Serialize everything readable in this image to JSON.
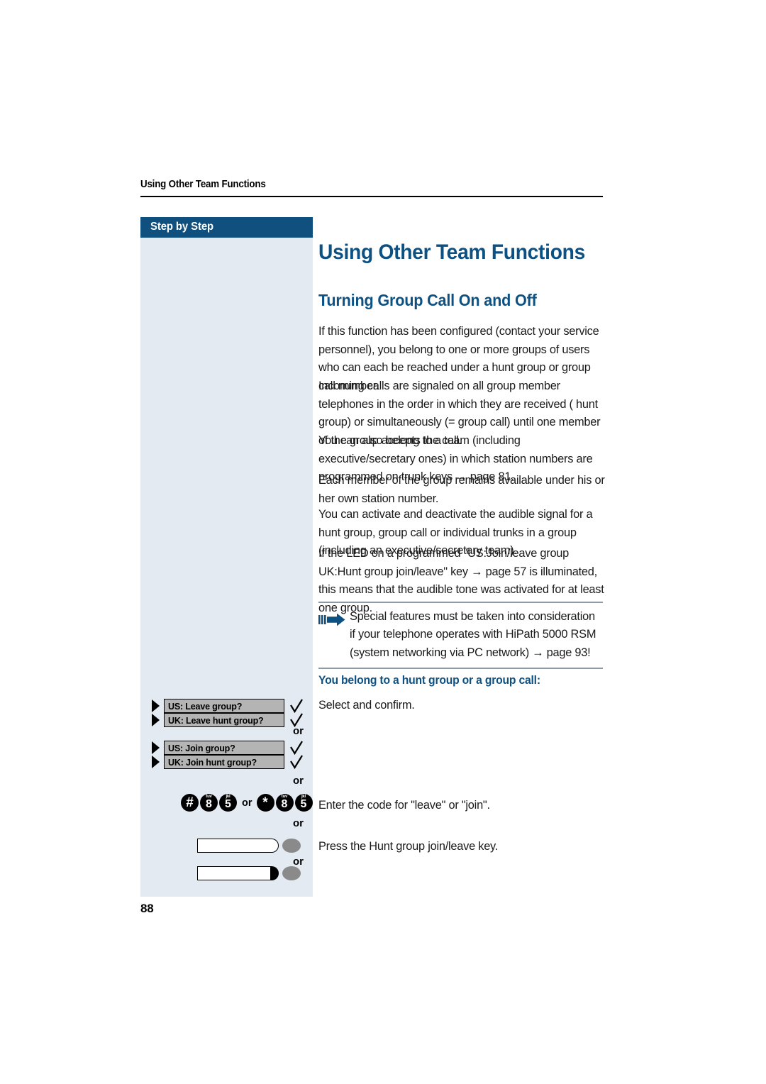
{
  "document": {
    "running_header": "Using Other Team Functions",
    "page_number": "88"
  },
  "sidebar": {
    "header_label": "Step by Step"
  },
  "headings": {
    "h1": "Using Other Team Functions",
    "h2": "Turning Group Call On and Off",
    "h3": "You belong to a hunt group or a group call:"
  },
  "body": {
    "para1": "If this function has been configured (contact your service personnel), you belong to one or more groups of users who can each be reached under a hunt group or group call number.",
    "para2": "Incoming calls are signaled on all group member telephones in the order in which they are received ( hunt group) or simultaneously (= group call) until one member of the group accepts the call.",
    "para3": "You can also belong to a team (including executive/secretary ones) in which station numbers are programmed on trunk keys → page 81.",
    "para4": "Each member of the group remains available under his or her own station number.",
    "para5": "You can activate and deactivate the audible signal for a hunt group, group call or individual trunks in a group (including an executive/secretary team).",
    "para6": "If the LED on a programmed \"US:Join/leave group UK:Hunt group join/leave\" key → page 57 is illuminated, this means that the audible tone was activated for at least one group."
  },
  "note": {
    "icon": "hand-pointer-arrow-icon",
    "text": "Special features must be taken into consideration if your telephone operates with HiPath 5000 RSM (system networking via PC network) → page 93!"
  },
  "steps": {
    "dialog_options": [
      {
        "label": "US: Leave group?",
        "confirm_icon": "check-icon"
      },
      {
        "label": "UK: Leave hunt group?",
        "confirm_icon": "check-icon"
      },
      {
        "label": "US: Join group?",
        "confirm_icon": "check-icon"
      },
      {
        "label": "UK: Join hunt group?",
        "confirm_icon": "check-icon"
      }
    ],
    "or_labels": {
      "a": "or",
      "b": "or",
      "c": "or",
      "d": "or"
    },
    "keypad": {
      "sequence_1": [
        {
          "glyph": "#",
          "letters": ""
        },
        {
          "glyph": "8",
          "letters": "tuv"
        },
        {
          "glyph": "5",
          "letters": "jkl"
        }
      ],
      "separator": "or",
      "sequence_2": [
        {
          "glyph": "*",
          "letters": ""
        },
        {
          "glyph": "8",
          "letters": "tuv"
        },
        {
          "glyph": "5",
          "letters": "jkl"
        }
      ]
    },
    "captions": {
      "select_confirm": "Select and confirm.",
      "enter_code": "Enter the code for \"leave\" or \"join\".",
      "press_key": "Press the Hunt group join/leave key."
    }
  },
  "colors": {
    "brand_blue": "#0d5082",
    "header_bar": "#10507f",
    "panel_bg": "#e3eaf2",
    "dialog_gray": "#b4b4b4",
    "led_gray": "#8a8a8a"
  }
}
